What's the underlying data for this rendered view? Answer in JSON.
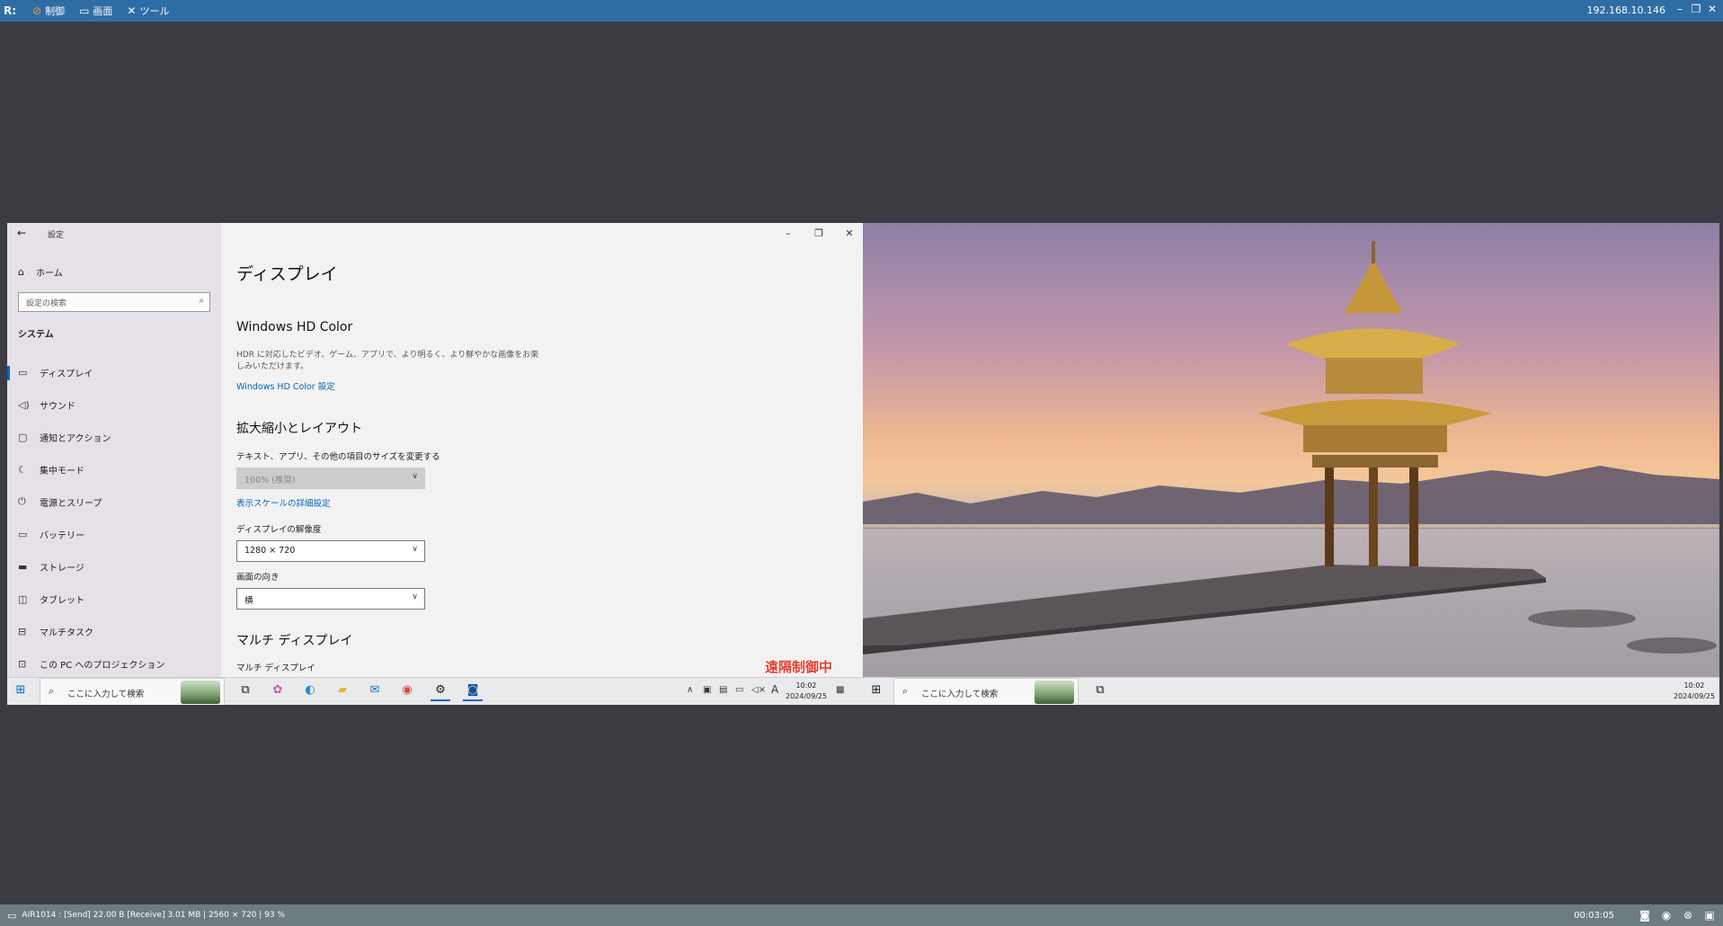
{
  "app": {
    "logo": "R:",
    "menus": [
      {
        "label": "制御",
        "icon": "control-icon"
      },
      {
        "label": "画面",
        "icon": "monitor-icon"
      },
      {
        "label": "ツール",
        "icon": "tools-icon"
      }
    ],
    "ip": "192.168.10.146",
    "accent": "#2e6da4"
  },
  "settings": {
    "title": "設定",
    "home": "ホーム",
    "search_placeholder": "設定の検索",
    "section": "システム",
    "nav": [
      {
        "label": "ディスプレイ",
        "icon": "monitor-icon",
        "active": true
      },
      {
        "label": "サウンド",
        "icon": "speaker-icon"
      },
      {
        "label": "通知とアクション",
        "icon": "notification-icon"
      },
      {
        "label": "集中モード",
        "icon": "moon-icon"
      },
      {
        "label": "電源とスリープ",
        "icon": "power-icon"
      },
      {
        "label": "バッテリー",
        "icon": "battery-icon"
      },
      {
        "label": "ストレージ",
        "icon": "storage-icon"
      },
      {
        "label": "タブレット",
        "icon": "tablet-icon"
      },
      {
        "label": "マルチタスク",
        "icon": "multitask-icon"
      },
      {
        "label": "この PC へのプロジェクション",
        "icon": "projection-icon"
      }
    ],
    "page_title": "ディスプレイ",
    "hd_color": {
      "heading": "Windows HD Color",
      "description": "HDR に対応したビデオ、ゲーム、アプリで、より明るく、より鮮やかな画像をお楽しみいただけます。",
      "link": "Windows HD Color 設定"
    },
    "scale": {
      "heading": "拡大縮小とレイアウト",
      "size_label": "テキスト、アプリ、その他の項目のサイズを変更する",
      "size_value": "100% (推奨)",
      "advanced_link": "表示スケールの詳細設定",
      "resolution_label": "ディスプレイの解像度",
      "resolution_value": "1280 × 720",
      "orientation_label": "画面の向き",
      "orientation_value": "横"
    },
    "multi": {
      "heading": "マルチ ディスプレイ",
      "label": "マルチ ディスプレイ"
    },
    "remote_badge": "遠隔制御中"
  },
  "taskbar1": {
    "search": "ここに入力して検索",
    "time": "10:02",
    "date": "2024/09/25",
    "ime": "A"
  },
  "taskbar2": {
    "search": "ここに入力して検索",
    "time": "10:02",
    "date": "2024/09/25"
  },
  "status": {
    "text": "AIR1014 : [Send] 22.00 B  [Receive] 3.01 MB | 2560 × 720 | 93 %",
    "timer": "00:03:05"
  }
}
